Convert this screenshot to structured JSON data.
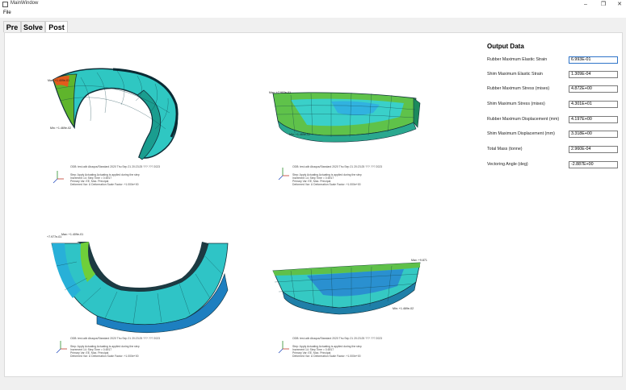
{
  "window": {
    "title": "MainWindow",
    "minimize": "–",
    "maximize": "❐",
    "close": "✕"
  },
  "menu": {
    "file": "File"
  },
  "tabs": [
    {
      "label": "Pre"
    },
    {
      "label": "Solve"
    },
    {
      "label": "Post"
    }
  ],
  "views": [
    {
      "id": "view-top-left",
      "odb_line": "ODB: test.odb    Abaqus/Standard 2020    Thu Sep 21 20:23:25 ??? ??? 2023",
      "step_line": "Step: Apply Actuating  Actuating is applied during the step",
      "increment_line": "Increment    14: Step Time =   0.6917",
      "primary_line": "Primary Var: EE, Max. Principal",
      "deformed_line": "Deformed Var: U   Deformation Scale Factor: +1.000e+00",
      "annot_max": "Max: +1.409e-01",
      "annot_min": "Min: +1.469e-02"
    },
    {
      "id": "view-top-right",
      "odb_line": "ODB: test.odb    Abaqus/Standard 2020    Thu Sep 21 20:23:25 ??? ??? 2023",
      "step_line": "Step: Apply Actuating  Actuating is applied during the step",
      "increment_line": "Increment    14: Step Time =   0.6917",
      "primary_line": "Primary Var: EE, Max. Principal",
      "deformed_line": "Deformed Var: U   Deformation Scale Factor: +1.000e+00",
      "annot_max": "Max: +7.903e-01",
      "annot_min": "Min: +1.469e-02"
    },
    {
      "id": "view-bottom-left",
      "odb_line": "ODB: test.odb    Abaqus/Standard 2020    Thu Sep 21 20:23:25 ??? ??? 2023",
      "step_line": "Step: Apply Actuating  Actuating is applied during the step",
      "increment_line": "Increment    14: Step Time =   0.6917",
      "primary_line": "Primary Var: EE, Max. Principal",
      "deformed_line": "Deformed Var: U   Deformation Scale Factor: +1.000e+00",
      "annot_max": "Max: +1.409e-01",
      "annot_min": "+7.977e-01"
    },
    {
      "id": "view-bottom-right",
      "odb_line": "ODB: test.odb    Abaqus/Standard 2020    Thu Sep 21 20:23:25 ??? ??? 2023",
      "step_line": "Step: Apply Actuating  Actuating is applied during the step",
      "increment_line": "Increment    14: Step Time =   0.6917",
      "primary_line": "Primary Var: EE, Max. Principal",
      "deformed_line": "Deformed Var: U   Deformation Scale Factor: +1.000e+00",
      "annot_max": "Max: +9.871",
      "annot_min": "Min: +1.469e-02"
    }
  ],
  "output": {
    "title": "Output Data",
    "rows": [
      {
        "label": "Rubber Maximum Elastic Strain",
        "value": "6.993E-01"
      },
      {
        "label": "Shim Maximum Elastic Strain",
        "value": "1.309E-04"
      },
      {
        "label": "Rubber Maximum Stress (mises)",
        "value": "4.872E+00"
      },
      {
        "label": "Shim Maximum Stress (mises)",
        "value": "4.301E+01"
      },
      {
        "label": "Rubber Maximum Displacement (mm)",
        "value": "4.197E+00"
      },
      {
        "label": "Shim Maximum Displacement (mm)",
        "value": "3.318E+00"
      },
      {
        "label": "Total Mass (tonne)",
        "value": "2.960E-04"
      },
      {
        "label": "Vectoring Angle (deg)",
        "value": "-2.887E+00"
      }
    ]
  },
  "colors": {
    "accent": "#2f74c8",
    "contour_low": "#1f3fbf",
    "contour_mid": "#2fd3c8",
    "contour_high": "#e23b1a"
  }
}
